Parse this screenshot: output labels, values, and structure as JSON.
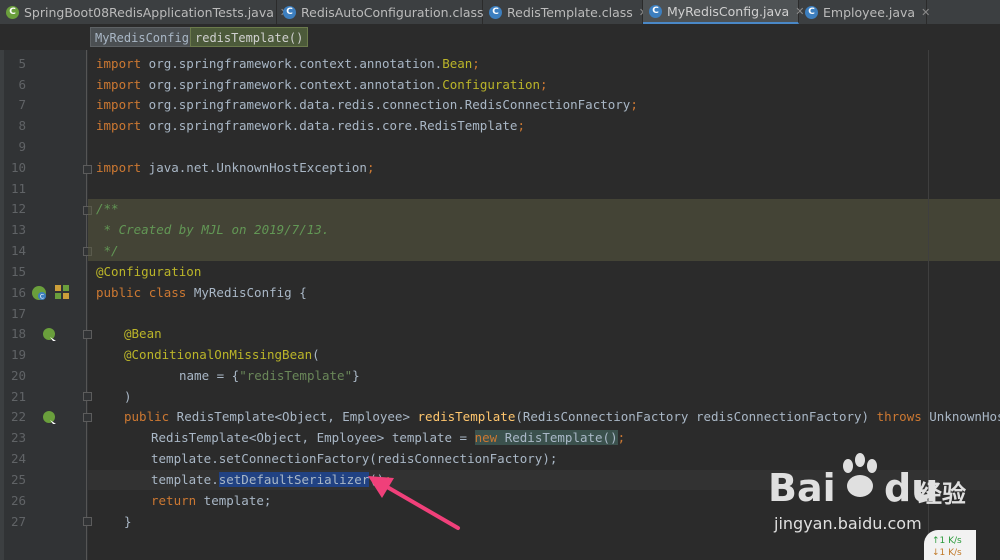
{
  "tabs": [
    {
      "label": "SpringBoot08RedisApplicationTests.java",
      "icon": "spring-class-icon",
      "active": false
    },
    {
      "label": "RedisAutoConfiguration.class",
      "icon": "class-icon",
      "active": false
    },
    {
      "label": "RedisTemplate.class",
      "icon": "class-icon",
      "active": false
    },
    {
      "label": "MyRedisConfig.java",
      "icon": "class-icon",
      "active": true
    },
    {
      "label": "Employee.java",
      "icon": "class-icon",
      "active": false
    }
  ],
  "breadcrumb": {
    "class_name": "MyRedisConfig",
    "method_name": "redisTemplate()"
  },
  "gutter": {
    "line_numbers": [
      "5",
      "6",
      "7",
      "8",
      "9",
      "10",
      "11",
      "12",
      "13",
      "14",
      "15",
      "16",
      "17",
      "18",
      "19",
      "20",
      "21",
      "22",
      "23",
      "24",
      "25",
      "26",
      "27"
    ]
  },
  "code": {
    "l5": {
      "kw": "import",
      "rest": " org.springframework.context.annotation.",
      "cls": "Bean",
      "end": ";"
    },
    "l6": {
      "kw": "import",
      "rest": " org.springframework.context.annotation.",
      "cls": "Configuration",
      "end": ";"
    },
    "l7": {
      "kw": "import",
      "rest": " org.springframework.data.redis.connection.RedisConnectionFactory",
      "end": ";"
    },
    "l8": {
      "kw": "import",
      "rest": " org.springframework.data.redis.core.RedisTemplate",
      "end": ";"
    },
    "l10": {
      "kw": "import",
      "rest": " java.net.UnknownHostException",
      "end": ";"
    },
    "l12": {
      "text": "/**"
    },
    "l13": {
      "text": " * Created by MJL on 2019/7/13."
    },
    "l14": {
      "text": " */"
    },
    "l15": {
      "text": "@Configuration"
    },
    "l16": {
      "kw1": "public",
      "kw2": "class",
      "rest": " MyRedisConfig {"
    },
    "l18": {
      "text": "@Bean"
    },
    "l19": {
      "ann": "@ConditionalOnMissingBean",
      "rest": "("
    },
    "l20": {
      "pre": "name = {",
      "str": "\"redisTemplate\"",
      "post": "}"
    },
    "l21": {
      "text": ")"
    },
    "l22": {
      "kw": "public",
      "type": " RedisTemplate<Object, Employee> ",
      "fn": "redisTemplate",
      "params": "(RedisConnectionFactory redisConnectionFactory) ",
      "kw2": "throws",
      "exc": " UnknownHostException {"
    },
    "l23": {
      "pre": "RedisTemplate<Object, Employee> template = ",
      "kw": "new",
      "ctor": " RedisTemplate()",
      "end": ";"
    },
    "l24": {
      "text": "template.setConnectionFactory(redisConnectionFactory);"
    },
    "l25": {
      "pre": "template.",
      "sel": "setDefaultSerializer",
      "post": "()",
      "end": ";"
    },
    "l26": {
      "kw": "return",
      "rest": " template;"
    },
    "l27": {
      "text": "}"
    }
  },
  "watermark": {
    "brand": "Bai",
    "brand_suffix": "du",
    "product": "经验",
    "url": "jingyan.baidu.com"
  },
  "corner": {
    "up": "↑1  K/s",
    "down": "↓1  K/s"
  },
  "colors": {
    "keyword": "#cc7832",
    "annotation": "#bbb529",
    "string": "#6a8759",
    "comment": "#629755",
    "method": "#ffc66d",
    "arrow": "#f0407a"
  }
}
